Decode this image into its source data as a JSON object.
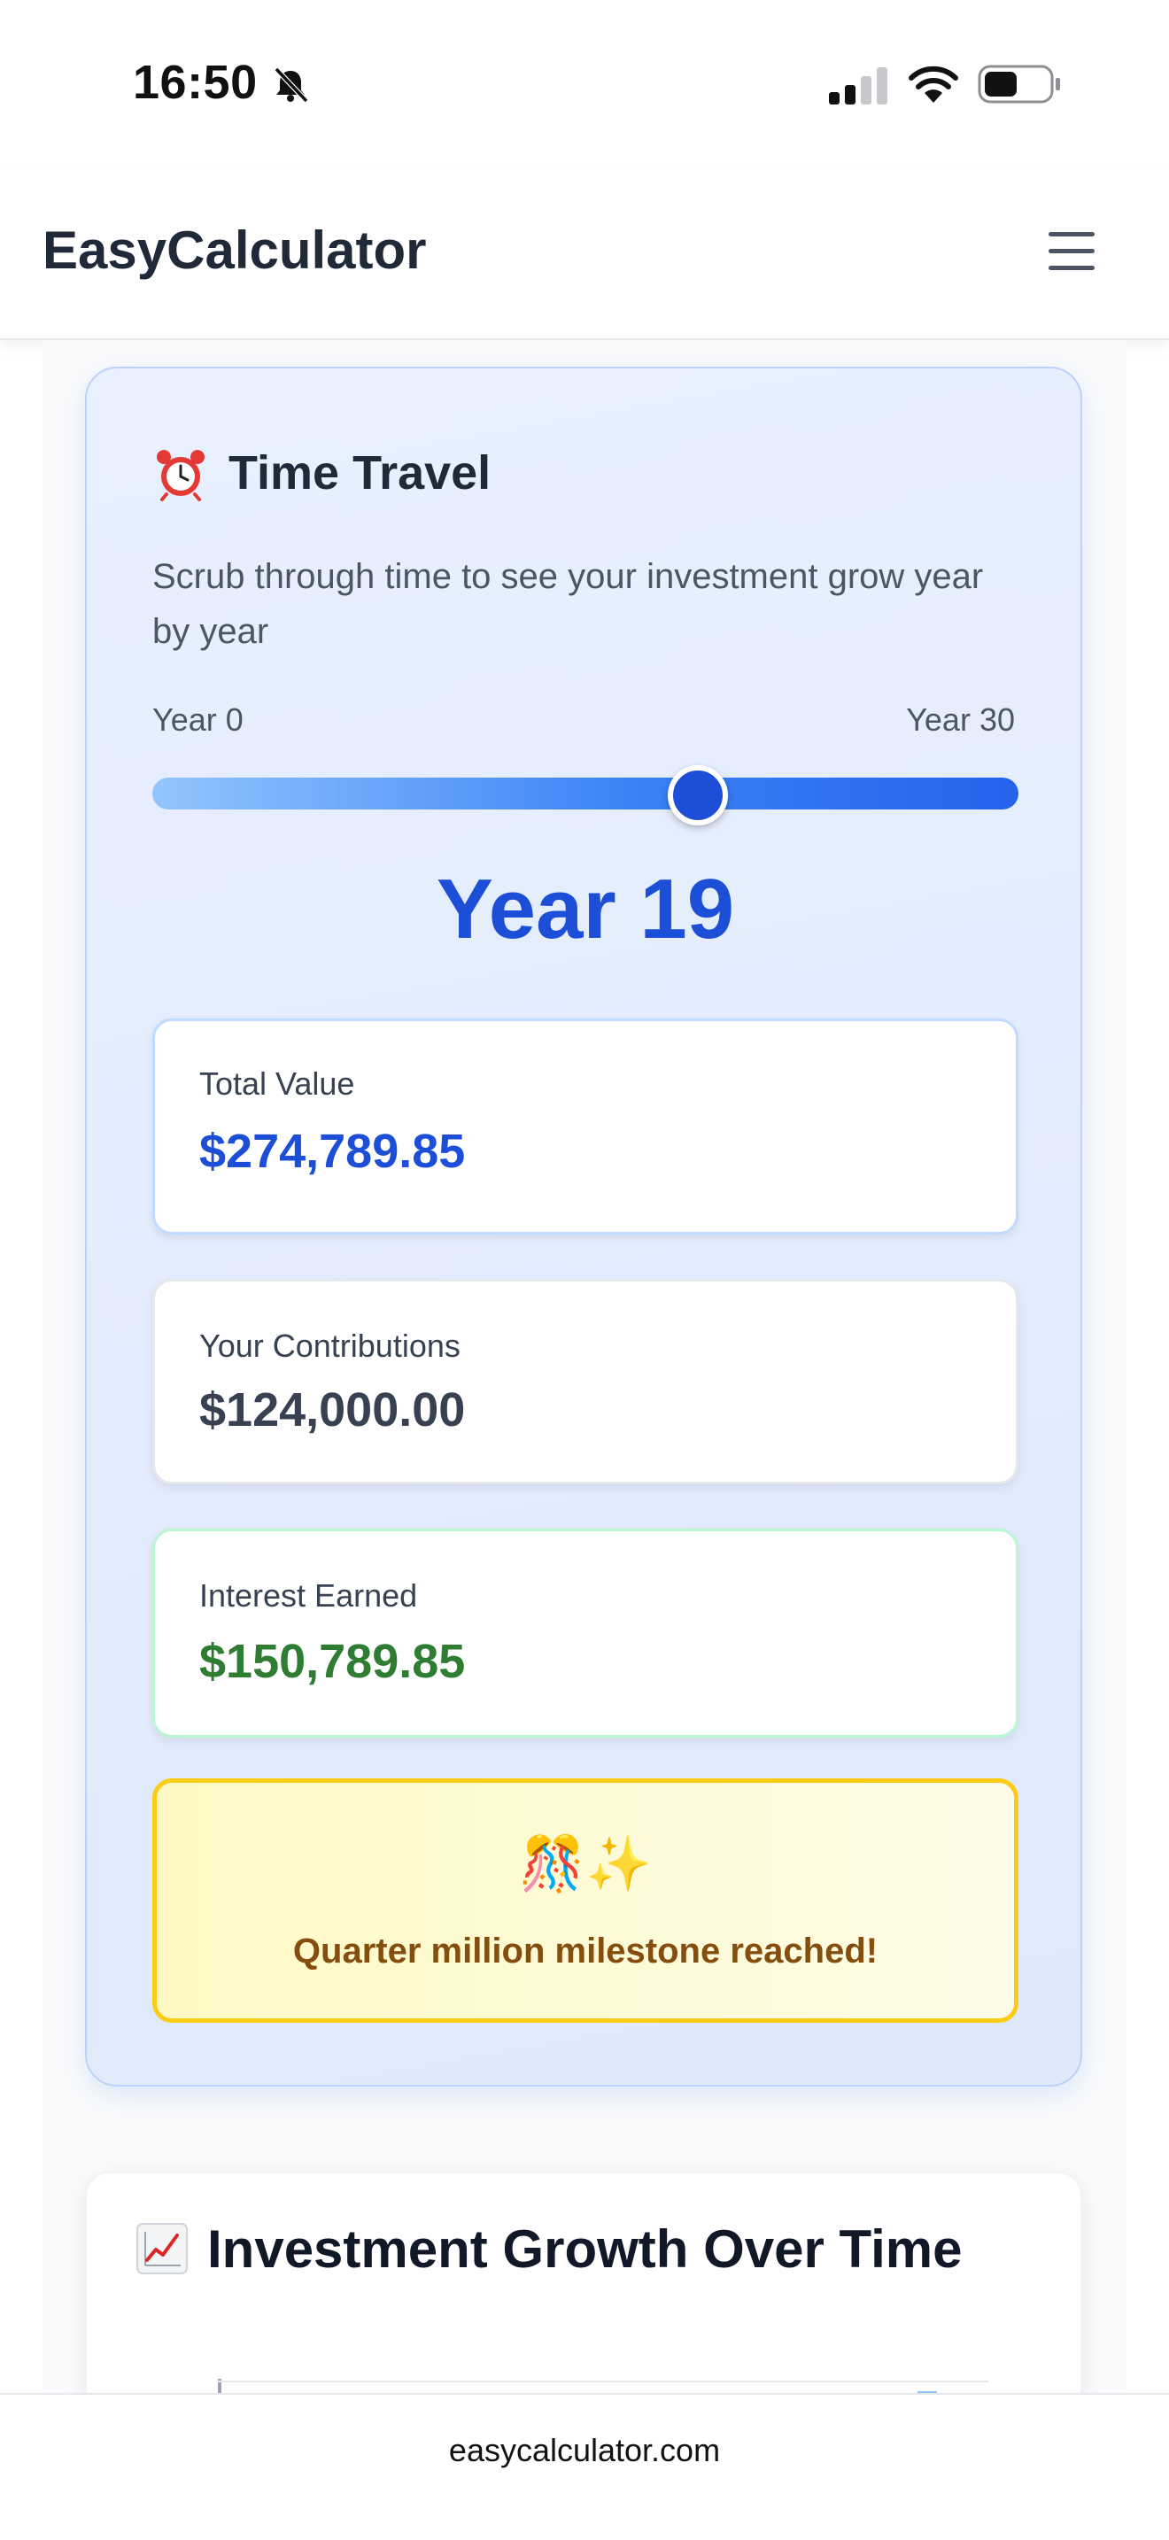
{
  "status_bar": {
    "time": "16:50"
  },
  "header": {
    "brand": "EasyCalculator"
  },
  "time_travel": {
    "title": "Time Travel",
    "description": "Scrub through time to see your investment grow year by year",
    "start_label": "Year 0",
    "end_label": "Year 30",
    "slider": {
      "min": 0,
      "max": 30,
      "value": 19
    },
    "current_year": "Year 19",
    "total_value": {
      "label": "Total Value",
      "value": "$274,789.85"
    },
    "contributions": {
      "label": "Your Contributions",
      "value": "$124,000.00"
    },
    "interest": {
      "label": "Interest Earned",
      "value": "$150,789.85"
    },
    "milestone": {
      "icons": "🎊✨",
      "text": "Quarter million milestone reached!"
    }
  },
  "growth": {
    "title": "Investment Growth Over Time"
  },
  "browser": {
    "url": "easycalculator.com"
  },
  "colors": {
    "accent": "#1d4ed8",
    "interest_green": "#2e7d32",
    "milestone_border": "#facc15",
    "milestone_text": "#854d0e"
  },
  "icons": {
    "alarm": "alarm-clock-icon",
    "celebration": "confetti-icon",
    "chart": "chart-increasing-icon",
    "menu": "hamburger-menu-icon"
  }
}
